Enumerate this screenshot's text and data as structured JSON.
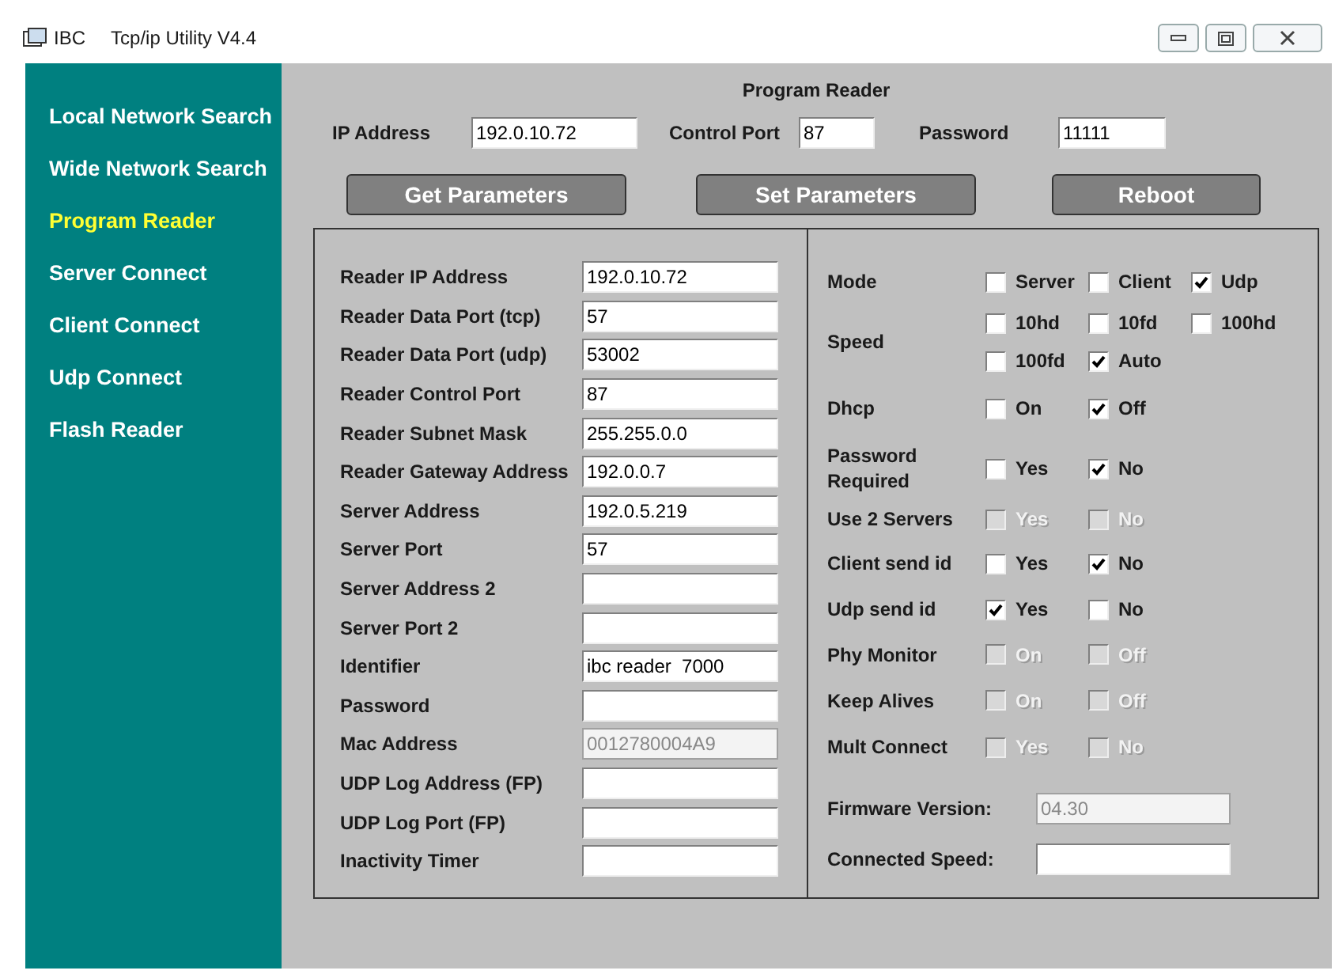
{
  "window": {
    "app": "IBC",
    "title": "Tcp/ip Utility V4.4"
  },
  "sidebar": {
    "items": [
      {
        "label": "Local Network Search",
        "selected": false
      },
      {
        "label": "Wide Network Search",
        "selected": false
      },
      {
        "label": "Program Reader",
        "selected": true
      },
      {
        "label": "Server Connect",
        "selected": false
      },
      {
        "label": "Client Connect",
        "selected": false
      },
      {
        "label": "Udp Connect",
        "selected": false
      },
      {
        "label": "Flash Reader",
        "selected": false
      }
    ]
  },
  "heading": "Program Reader",
  "connection": [
    {
      "label": "IP Address",
      "value": "192.0.10.72"
    },
    {
      "label": "Control Port",
      "value": "87"
    },
    {
      "label": "Password",
      "value": "11111"
    }
  ],
  "buttons": [
    "Get  Parameters",
    "Set  Parameters",
    "Reboot"
  ],
  "fields": [
    {
      "label": "Reader IP Address",
      "value": "192.0.10.72",
      "disabled": false
    },
    {
      "label": "Reader Data Port (tcp)",
      "value": "57",
      "disabled": false
    },
    {
      "label": "Reader Data Port (udp)",
      "value": "53002",
      "disabled": false
    },
    {
      "label": "Reader Control Port",
      "value": "87",
      "disabled": false
    },
    {
      "label": "Reader Subnet Mask",
      "value": "255.255.0.0",
      "disabled": false
    },
    {
      "label": "Reader Gateway Address",
      "value": "192.0.0.7",
      "disabled": false
    },
    {
      "label": "Server Address",
      "value": "192.0.5.219",
      "disabled": false
    },
    {
      "label": "Server Port",
      "value": "57",
      "disabled": false
    },
    {
      "label": "Server Address 2",
      "disabled": false
    },
    {
      "label": "Server Port 2",
      "disabled": false
    },
    {
      "label": "Identifier",
      "value": "ibc reader  7000",
      "disabled": false
    },
    {
      "label": "Password",
      "disabled": false
    },
    {
      "label": "Mac Address",
      "value": "0012780004A9",
      "disabled": true
    },
    {
      "label": "UDP Log Address (FP)",
      "disabled": false
    },
    {
      "label": "UDP Log Port (FP)",
      "disabled": false
    },
    {
      "label": "Inactivity Timer",
      "disabled": false
    }
  ],
  "settings": [
    {
      "label": "Mode",
      "options": [
        {
          "label": "Server",
          "checked": false,
          "disabled": false
        },
        {
          "label": "Client",
          "checked": false,
          "disabled": false
        },
        {
          "label": "Udp",
          "checked": true,
          "disabled": false
        }
      ]
    },
    {
      "label": "Speed",
      "options": [
        {
          "label": "10hd",
          "checked": false,
          "disabled": false
        },
        {
          "label": "10fd",
          "checked": false,
          "disabled": false
        },
        {
          "label": "100hd",
          "checked": false,
          "disabled": false
        },
        {
          "label": "100fd",
          "checked": false,
          "disabled": false
        },
        {
          "label": "Auto",
          "checked": true,
          "disabled": false
        }
      ]
    },
    {
      "label": "Dhcp",
      "options": [
        {
          "label": "On",
          "checked": false,
          "disabled": false
        },
        {
          "label": "Off",
          "checked": true,
          "disabled": false
        }
      ]
    },
    {
      "label": "Password Required",
      "options": [
        {
          "label": "Yes",
          "checked": false,
          "disabled": false
        },
        {
          "label": "No",
          "checked": true,
          "disabled": false
        }
      ]
    },
    {
      "label": "Use 2 Servers",
      "options": [
        {
          "label": "Yes",
          "checked": false,
          "disabled": true
        },
        {
          "label": "No",
          "checked": false,
          "disabled": true
        }
      ]
    },
    {
      "label": "Client send id",
      "options": [
        {
          "label": "Yes",
          "checked": false,
          "disabled": false
        },
        {
          "label": "No",
          "checked": true,
          "disabled": false
        }
      ]
    },
    {
      "label": "Udp send id",
      "options": [
        {
          "label": "Yes",
          "checked": true,
          "disabled": false
        },
        {
          "label": "No",
          "checked": false,
          "disabled": false
        }
      ]
    },
    {
      "label": "Phy Monitor",
      "options": [
        {
          "label": "On",
          "checked": false,
          "disabled": true
        },
        {
          "label": "Off",
          "checked": false,
          "disabled": true
        }
      ]
    },
    {
      "label": "Keep Alives",
      "options": [
        {
          "label": "On",
          "checked": false,
          "disabled": true
        },
        {
          "label": "Off",
          "checked": false,
          "disabled": true
        }
      ]
    },
    {
      "label": "Mult Connect",
      "options": [
        {
          "label": "Yes",
          "checked": false,
          "disabled": true
        },
        {
          "label": "No",
          "checked": false,
          "disabled": true
        }
      ]
    }
  ],
  "info": [
    {
      "label": "Firmware Version:",
      "value": "04.30",
      "disabled": true
    },
    {
      "label": "Connected Speed:",
      "disabled": false
    }
  ]
}
